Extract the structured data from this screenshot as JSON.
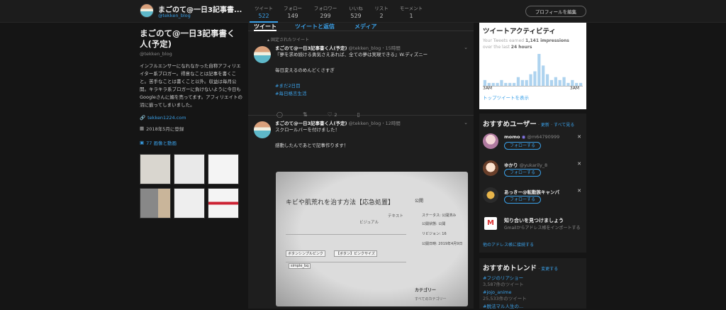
{
  "topbar": {
    "name": "まごのて@一日3記事書...",
    "handle": "@tekken_blog",
    "stats": [
      {
        "label": "ツイート",
        "value": "522"
      },
      {
        "label": "フォロー",
        "value": "149"
      },
      {
        "label": "フォロワー",
        "value": "299"
      },
      {
        "label": "いいね",
        "value": "529"
      },
      {
        "label": "リスト",
        "value": "2"
      },
      {
        "label": "モーメント",
        "value": "1"
      }
    ],
    "edit_profile": "プロフィールを編集"
  },
  "profile": {
    "name": "まごのて@一日3記事書く人(予定)",
    "handle": "@tekken_blog",
    "bio": "インフルエンサーになれなかった自称アフィリエイター系ブロガー。得意なことは記事を書くこと。苦手なことは書くこと以外。収益は毎月公開。キラキラ系ブロガーに負けないように今日もGoogleさんに媚を売ってます。アフィリエイトの沼に嵌ってしまいました。",
    "url": "tekken1224.com",
    "joined": "2018年5月に登録",
    "media_link": "77 画像と動画"
  },
  "feed": {
    "tabs": [
      "ツイート",
      "ツイートと返信",
      "メディア"
    ],
    "pinned_label": "固定されたツイート",
    "tweet1": {
      "name": "まごのて@一日3記事書く人(予定)",
      "handle": "@tekken_blog",
      "time": "15時間",
      "line1": "『夢を求め続ける勇気さえあれば、全ての夢は実現できる』W.ディズニー",
      "line2": "毎日変えるのめんどくさすぎ",
      "tag1": "#まだ2日目",
      "tag2": "#毎日格言生活",
      "likes": "2"
    },
    "tweet2": {
      "name": "まごのて@一日3記事書く人(予定)",
      "handle": "@tekken_blog",
      "time": "12時間",
      "line1": "スクロールバーを付けました！",
      "line2": "感動したんであとで記事作ります！",
      "photo_title": "キビや肌荒れを治す方法【応急処置】",
      "photo_words": [
        "公開",
        "テキスト",
        "ビジュアル",
        "ステータス: 公開済み",
        "公開状態: 公開",
        "リビジョン: 16",
        "公開日時: 2019年4月9日",
        "カテゴリー",
        "すべてのカテゴリー",
        "simple_bq",
        "ボタンシンプルピンク",
        "【ボタン】ピンクサイズ"
      ]
    }
  },
  "activity": {
    "title": "ツイートアクティビティ",
    "line1a": "Your Tweets earned ",
    "impressions": "1,141 impressions",
    "line2a": "over the last ",
    "period": "24 hours",
    "axis_left": "3AM",
    "axis_right": "3AM",
    "top_tweets": "トップツイートを表示"
  },
  "chart_data": {
    "type": "bar",
    "title": "",
    "values": [
      2,
      1,
      1,
      1,
      2,
      1,
      1,
      1,
      3,
      2,
      2,
      4,
      5,
      11,
      7,
      4,
      2,
      3,
      2,
      3,
      1,
      2,
      1,
      1
    ]
  },
  "suggest": {
    "title": "おすすめユーザー",
    "refresh": "更新",
    "view_all": "すべて見る",
    "users": [
      {
        "name": "momo",
        "handle": "@m64790999",
        "follow": "フォローする"
      },
      {
        "name": "ゆかり",
        "handle": "@yukarily_8",
        "follow": "フォローする"
      },
      {
        "name": "あっきー@転勤族キャンパ",
        "handle": "",
        "follow": "フォローする"
      }
    ],
    "find_title": "知り合いを見つけましょう",
    "find_sub": "Gmailからアドレス帳をインポートする",
    "connect": "他のアドレス帳に接続する"
  },
  "trends": {
    "title": "おすすめトレンド",
    "change": "変更する",
    "items": [
      {
        "tag": "#フジのリアショー",
        "count": "3,587件のツイート"
      },
      {
        "tag": "#jojo_anime",
        "count": "25,533件のツイート"
      },
      {
        "tag": "#脱法マル人生の...",
        "count": ""
      }
    ]
  }
}
